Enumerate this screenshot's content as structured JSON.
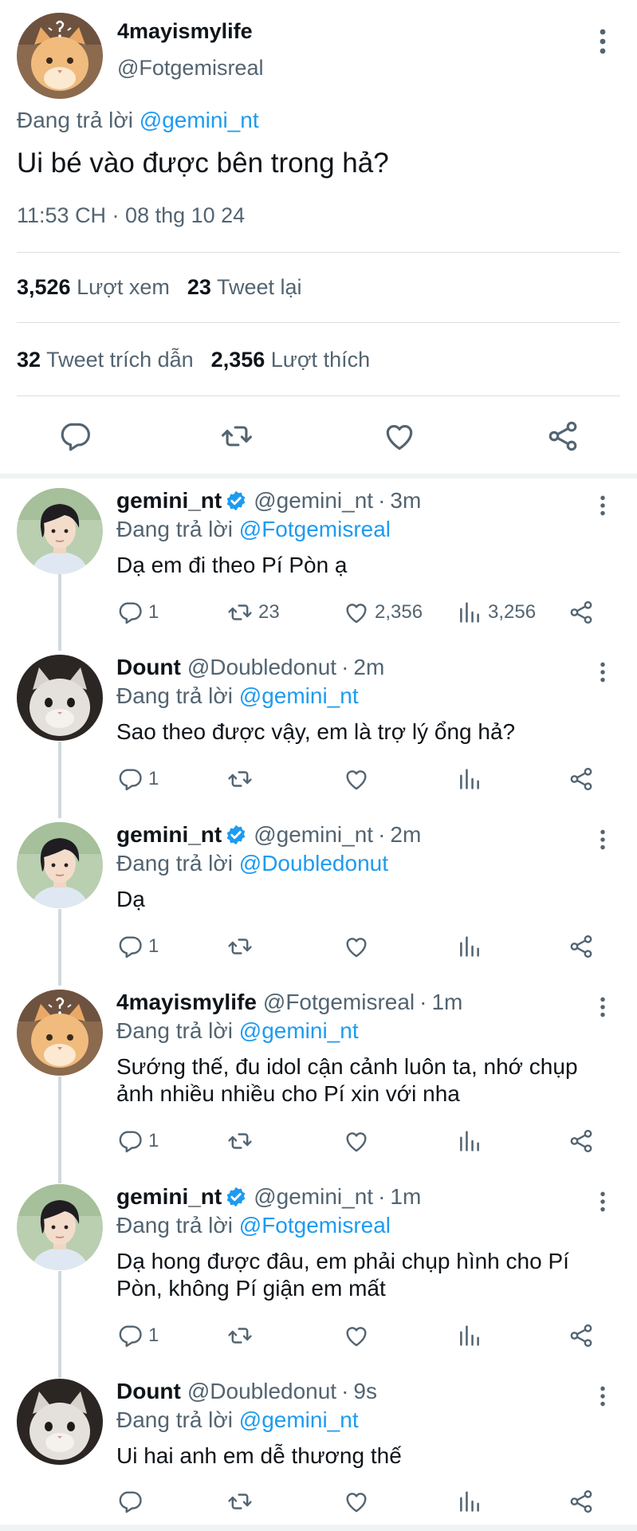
{
  "main_tweet": {
    "avatar": "orange-cat-avatar",
    "display_name": "4mayismylife",
    "handle": "@Fotgemisreal",
    "replying_prefix": "Đang trả lời",
    "replying_to": "@gemini_nt",
    "text": "Ui bé vào được bên trong hả?",
    "timestamp": "11:53 CH · 08 thg 10 24",
    "stats": {
      "views_count": "3,526",
      "views_label": "Lượt xem",
      "retweets_count": "23",
      "retweets_label": "Tweet lại",
      "quotes_count": "32",
      "quotes_label": "Tweet trích dẫn",
      "likes_count": "2,356",
      "likes_label": "Lượt thích"
    },
    "actions": [
      "reply-icon",
      "retweet-icon",
      "like-icon",
      "share-icon"
    ]
  },
  "replies": [
    {
      "avatar": "young-man-avatar",
      "display_name": "gemini_nt",
      "verified": true,
      "handle": "@gemini_nt",
      "time": "3m",
      "replying_prefix": "Đang trả lời",
      "replying_to": "@Fotgemisreal",
      "text": "Dạ em đi theo Pí Pòn ạ",
      "replies": "1",
      "retweets": "23",
      "likes": "2,356",
      "views": "3,256"
    },
    {
      "avatar": "grey-cat-avatar",
      "display_name": "Dount",
      "verified": false,
      "handle": "@Doubledonut",
      "time": "2m",
      "replying_prefix": "Đang trả lời",
      "replying_to": "@gemini_nt",
      "text": "Sao theo được vậy, em là trợ lý ổng hả?",
      "replies": "1",
      "retweets": "",
      "likes": "",
      "views": ""
    },
    {
      "avatar": "young-man-avatar",
      "display_name": "gemini_nt",
      "verified": true,
      "handle": "@gemini_nt",
      "time": "2m",
      "replying_prefix": "Đang trả lời",
      "replying_to": "@Doubledonut",
      "text": "Dạ",
      "replies": "1",
      "retweets": "",
      "likes": "",
      "views": ""
    },
    {
      "avatar": "orange-cat-avatar",
      "display_name": "4mayismylife",
      "verified": false,
      "handle": "@Fotgemisreal",
      "time": "1m",
      "replying_prefix": "Đang trả lời",
      "replying_to": "@gemini_nt",
      "text": "Sướng thế, đu idol cận cảnh luôn ta, nhớ chụp ảnh nhiều nhiều cho Pí xin với nha",
      "replies": "1",
      "retweets": "",
      "likes": "",
      "views": ""
    },
    {
      "avatar": "young-man-avatar",
      "display_name": "gemini_nt",
      "verified": true,
      "handle": "@gemini_nt",
      "time": "1m",
      "replying_prefix": "Đang trả lời",
      "replying_to": "@Fotgemisreal",
      "text": "Dạ hong được đâu, em phải chụp hình cho Pí Pòn, không Pí giận em mất",
      "replies": "1",
      "retweets": "",
      "likes": "",
      "views": ""
    },
    {
      "avatar": "grey-cat-avatar",
      "display_name": "Dount",
      "verified": false,
      "handle": "@Doubledonut",
      "time": "9s",
      "replying_prefix": "Đang trả lời",
      "replying_to": "@gemini_nt",
      "text": "Ui hai anh em dễ thương thế",
      "replies": "",
      "retweets": "",
      "likes": "",
      "views": ""
    }
  ],
  "colors": {
    "text_primary": "#0f1419",
    "text_secondary": "#536471",
    "link": "#1d9bf0",
    "verified": "#1d9bf0",
    "divider": "#d9dfe3",
    "thread_line": "#cfd9de"
  }
}
